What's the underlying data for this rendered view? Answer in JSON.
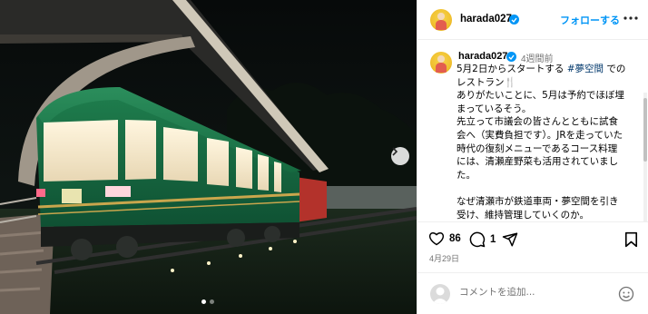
{
  "post": {
    "username": "harada027",
    "follow_label": "フォローする",
    "more_icon": "more-horizontal-icon",
    "verified_icon": "verified-badge-icon",
    "time_ago": "4週間前",
    "caption_line1_prefix": "5月2日からスタートする ",
    "caption_hashtag": "#夢空間",
    "caption_line1_suffix": " での",
    "caption_line2": "レストラン🍴",
    "caption_body": "ありがたいことに、5月は予約でほぼ埋\nまっているそう。\n先立って市議会の皆さんとともに試食\n会へ（実費負担です）。JRを走っていた\n時代の復刻メニューであるコース料理\nには、清瀬産野菜も活用されていまし\nた。\n\nなぜ清瀬市が鉄道車両・夢空間を引き\n受け、維持管理していくのか。\nこの疑問はまだまだ解消できない多く",
    "likes": "86",
    "comments": "1",
    "date": "4月29日",
    "comment_placeholder": "コメントを追加...",
    "carousel": {
      "current": 1,
      "total": 2
    }
  },
  "icons": {
    "like": "heart-icon",
    "comment": "comment-icon",
    "share": "share-icon",
    "save": "bookmark-icon",
    "emoji": "emoji-icon",
    "next": "chevron-right-icon"
  },
  "colors": {
    "accent": "#0095f6",
    "hashtag": "#00376b",
    "muted": "#737373",
    "train_green": "#1f7a4c"
  }
}
